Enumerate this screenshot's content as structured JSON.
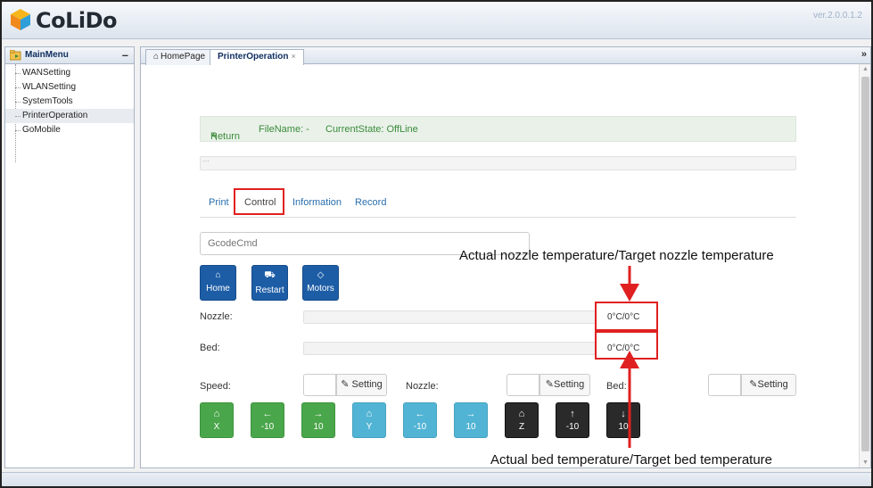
{
  "app": {
    "logo_text": "CoLiDo",
    "version": "ver.2.0.0.1.2"
  },
  "sidebar": {
    "title": "MainMenu",
    "collapse_label": "–",
    "items": [
      {
        "label": "WANSetting"
      },
      {
        "label": "WLANSetting"
      },
      {
        "label": "SystemTools"
      },
      {
        "label": "PrinterOperation",
        "selected": true
      },
      {
        "label": "GoMobile"
      }
    ]
  },
  "tabs": [
    {
      "label": "HomePage",
      "icon": "home-icon"
    },
    {
      "label": "PrinterOperation",
      "close": "×",
      "active": true
    }
  ],
  "tab_more": "»",
  "status": {
    "return": "Return",
    "filename": "FileName: -",
    "state": "CurrentState: OffLine"
  },
  "progress": {
    "value": 0
  },
  "control_tabs": [
    "Print",
    "Control",
    "Information",
    "Record"
  ],
  "gcode": {
    "placeholder": "GcodeCmd"
  },
  "action_buttons": [
    {
      "label": "Home",
      "icon": "home-icon"
    },
    {
      "label": "Restart",
      "icon": "truck-icon"
    },
    {
      "label": "Motors",
      "icon": "motors-icon"
    }
  ],
  "nozzle": {
    "label": "Nozzle:",
    "temp": "0°C/0°C",
    "fill": 0
  },
  "bed": {
    "label": "Bed:",
    "temp": "0°C/0°C",
    "fill": 0
  },
  "settings_row": {
    "speed_label": "Speed:",
    "nozzle_label": "Nozzle:",
    "bed_label": "Bed:",
    "setting_label": "Setting"
  },
  "move_buttons": [
    {
      "icon": "home-icon",
      "label": "X",
      "color": "#4aa64a"
    },
    {
      "icon": "arrow-left-icon",
      "label": "-10",
      "color": "#4aa64a"
    },
    {
      "icon": "arrow-right-icon",
      "label": "10",
      "color": "#4aa64a"
    },
    {
      "icon": "home-icon",
      "label": "Y",
      "color": "#52b4d4"
    },
    {
      "icon": "arrow-left-icon",
      "label": "-10",
      "color": "#52b4d4"
    },
    {
      "icon": "arrow-right-icon",
      "label": "10",
      "color": "#52b4d4"
    },
    {
      "icon": "home-icon",
      "label": "Z",
      "color": "#2a2a2a"
    },
    {
      "icon": "arrow-up-icon",
      "label": "-10",
      "color": "#2a2a2a"
    },
    {
      "icon": "arrow-down-icon",
      "label": "10",
      "color": "#2a2a2a"
    }
  ],
  "annotations": {
    "nozzle": "Actual nozzle temperature/Target nozzle temperature",
    "bed": "Actual bed temperature/Target bed temperature",
    "color": "#e02020"
  }
}
